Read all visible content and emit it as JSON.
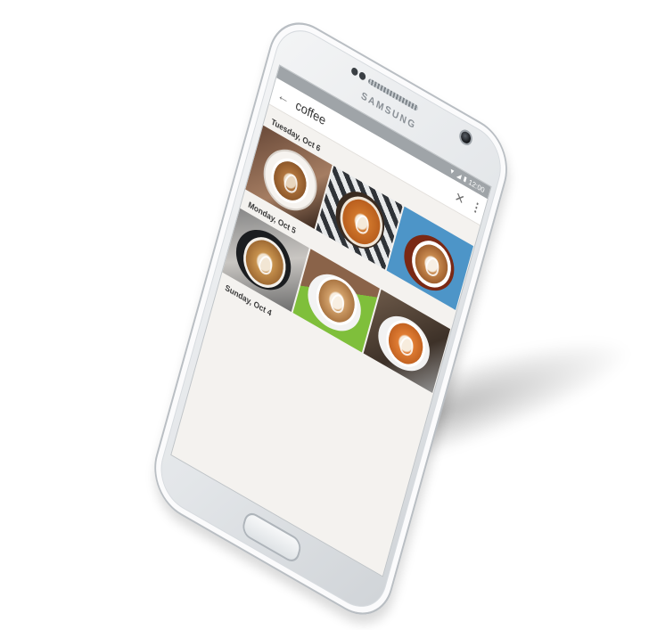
{
  "device": {
    "brand": "SAMSUNG"
  },
  "status_bar": {
    "time": "12:00",
    "icons": [
      "wifi-icon",
      "signal-icon",
      "battery-icon"
    ]
  },
  "search": {
    "query": "coffee",
    "back_icon": "arrow-left-icon",
    "clear_icon": "close-icon",
    "more_icon": "more-vert-icon"
  },
  "results": [
    {
      "date": "Tuesday, Oct 6",
      "photos": [
        "latte-art-photo",
        "latte-art-photo",
        "latte-art-photo"
      ]
    },
    {
      "date": "Monday, Oct 5",
      "photos": [
        "latte-art-photo",
        "latte-art-photo",
        "latte-art-photo"
      ]
    },
    {
      "date": "Sunday, Oct 4",
      "photos": []
    }
  ]
}
